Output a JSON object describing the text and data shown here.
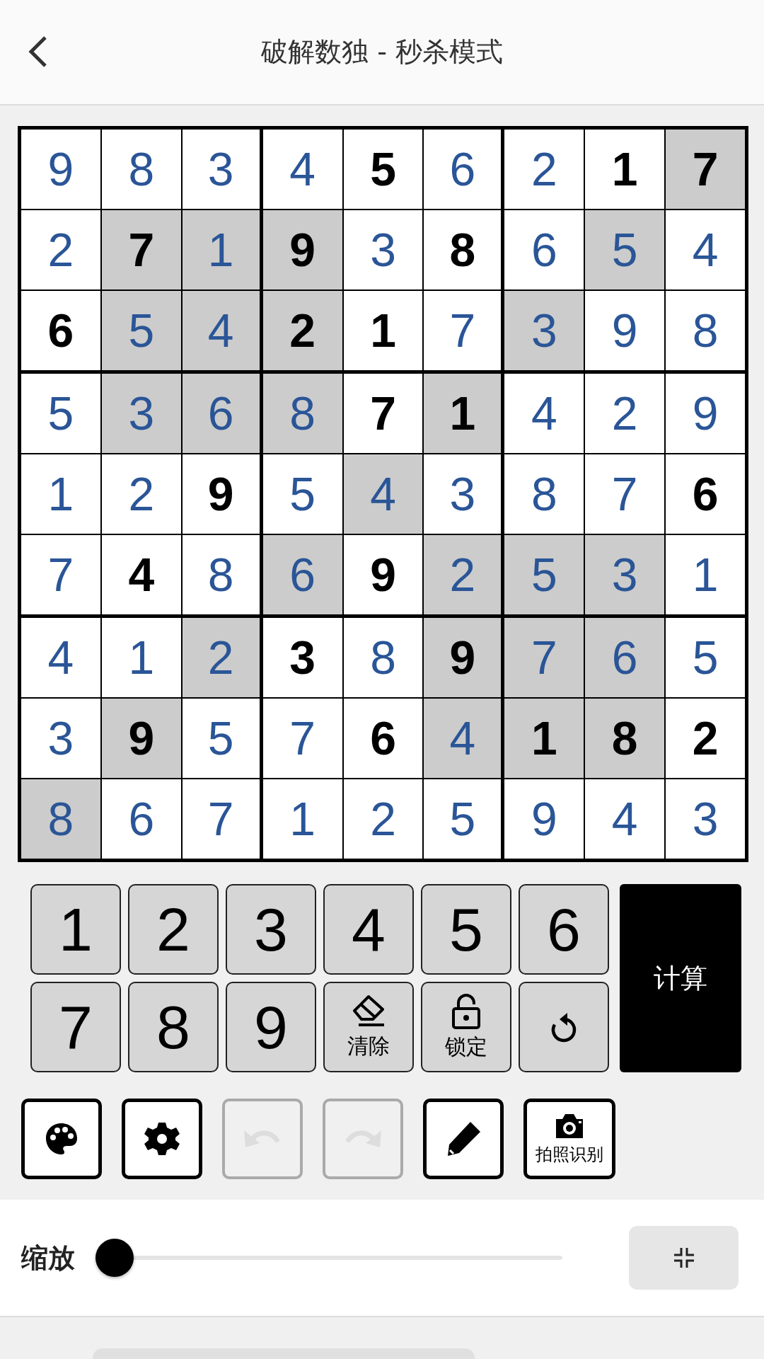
{
  "header": {
    "title": "破解数独 - 秒杀模式"
  },
  "grid": {
    "rows": [
      {
        "cells": [
          {
            "value": "9",
            "given": false,
            "shaded": false
          },
          {
            "value": "8",
            "given": false,
            "shaded": false
          },
          {
            "value": "3",
            "given": false,
            "shaded": false
          },
          {
            "value": "4",
            "given": false,
            "shaded": false
          },
          {
            "value": "5",
            "given": true,
            "shaded": false
          },
          {
            "value": "6",
            "given": false,
            "shaded": false
          },
          {
            "value": "2",
            "given": false,
            "shaded": false
          },
          {
            "value": "1",
            "given": true,
            "shaded": false
          },
          {
            "value": "7",
            "given": true,
            "shaded": true
          }
        ]
      },
      {
        "cells": [
          {
            "value": "2",
            "given": false,
            "shaded": false
          },
          {
            "value": "7",
            "given": true,
            "shaded": true
          },
          {
            "value": "1",
            "given": false,
            "shaded": true
          },
          {
            "value": "9",
            "given": true,
            "shaded": true
          },
          {
            "value": "3",
            "given": false,
            "shaded": false
          },
          {
            "value": "8",
            "given": true,
            "shaded": false
          },
          {
            "value": "6",
            "given": false,
            "shaded": false
          },
          {
            "value": "5",
            "given": false,
            "shaded": true
          },
          {
            "value": "4",
            "given": false,
            "shaded": false
          }
        ]
      },
      {
        "cells": [
          {
            "value": "6",
            "given": true,
            "shaded": false
          },
          {
            "value": "5",
            "given": false,
            "shaded": true
          },
          {
            "value": "4",
            "given": false,
            "shaded": true
          },
          {
            "value": "2",
            "given": true,
            "shaded": true
          },
          {
            "value": "1",
            "given": true,
            "shaded": false
          },
          {
            "value": "7",
            "given": false,
            "shaded": false
          },
          {
            "value": "3",
            "given": false,
            "shaded": true
          },
          {
            "value": "9",
            "given": false,
            "shaded": false
          },
          {
            "value": "8",
            "given": false,
            "shaded": false
          }
        ]
      },
      {
        "cells": [
          {
            "value": "5",
            "given": false,
            "shaded": false
          },
          {
            "value": "3",
            "given": false,
            "shaded": true
          },
          {
            "value": "6",
            "given": false,
            "shaded": true
          },
          {
            "value": "8",
            "given": false,
            "shaded": true
          },
          {
            "value": "7",
            "given": true,
            "shaded": false
          },
          {
            "value": "1",
            "given": true,
            "shaded": true
          },
          {
            "value": "4",
            "given": false,
            "shaded": false
          },
          {
            "value": "2",
            "given": false,
            "shaded": false
          },
          {
            "value": "9",
            "given": false,
            "shaded": false
          }
        ]
      },
      {
        "cells": [
          {
            "value": "1",
            "given": false,
            "shaded": false
          },
          {
            "value": "2",
            "given": false,
            "shaded": false
          },
          {
            "value": "9",
            "given": true,
            "shaded": false
          },
          {
            "value": "5",
            "given": false,
            "shaded": false
          },
          {
            "value": "4",
            "given": false,
            "shaded": true
          },
          {
            "value": "3",
            "given": false,
            "shaded": false
          },
          {
            "value": "8",
            "given": false,
            "shaded": false
          },
          {
            "value": "7",
            "given": false,
            "shaded": false
          },
          {
            "value": "6",
            "given": true,
            "shaded": false
          }
        ]
      },
      {
        "cells": [
          {
            "value": "7",
            "given": false,
            "shaded": false
          },
          {
            "value": "4",
            "given": true,
            "shaded": false
          },
          {
            "value": "8",
            "given": false,
            "shaded": false
          },
          {
            "value": "6",
            "given": false,
            "shaded": true
          },
          {
            "value": "9",
            "given": true,
            "shaded": false
          },
          {
            "value": "2",
            "given": false,
            "shaded": true
          },
          {
            "value": "5",
            "given": false,
            "shaded": true
          },
          {
            "value": "3",
            "given": false,
            "shaded": true
          },
          {
            "value": "1",
            "given": false,
            "shaded": false
          }
        ]
      },
      {
        "cells": [
          {
            "value": "4",
            "given": false,
            "shaded": false
          },
          {
            "value": "1",
            "given": false,
            "shaded": false
          },
          {
            "value": "2",
            "given": false,
            "shaded": true
          },
          {
            "value": "3",
            "given": true,
            "shaded": false
          },
          {
            "value": "8",
            "given": false,
            "shaded": false
          },
          {
            "value": "9",
            "given": true,
            "shaded": true
          },
          {
            "value": "7",
            "given": false,
            "shaded": true
          },
          {
            "value": "6",
            "given": false,
            "shaded": true
          },
          {
            "value": "5",
            "given": false,
            "shaded": false
          }
        ]
      },
      {
        "cells": [
          {
            "value": "3",
            "given": false,
            "shaded": false
          },
          {
            "value": "9",
            "given": true,
            "shaded": true
          },
          {
            "value": "5",
            "given": false,
            "shaded": false
          },
          {
            "value": "7",
            "given": false,
            "shaded": false
          },
          {
            "value": "6",
            "given": true,
            "shaded": false
          },
          {
            "value": "4",
            "given": false,
            "shaded": true
          },
          {
            "value": "1",
            "given": true,
            "shaded": true
          },
          {
            "value": "8",
            "given": true,
            "shaded": true
          },
          {
            "value": "2",
            "given": true,
            "shaded": false
          }
        ]
      },
      {
        "cells": [
          {
            "value": "8",
            "given": false,
            "shaded": true
          },
          {
            "value": "6",
            "given": false,
            "shaded": false
          },
          {
            "value": "7",
            "given": false,
            "shaded": false
          },
          {
            "value": "1",
            "given": false,
            "shaded": false
          },
          {
            "value": "2",
            "given": false,
            "shaded": false
          },
          {
            "value": "5",
            "given": false,
            "shaded": false
          },
          {
            "value": "9",
            "given": false,
            "shaded": false
          },
          {
            "value": "4",
            "given": false,
            "shaded": false
          },
          {
            "value": "3",
            "given": false,
            "shaded": false
          }
        ]
      }
    ]
  },
  "keypad": {
    "keys": [
      {
        "kind": "digit",
        "label": "1"
      },
      {
        "kind": "digit",
        "label": "2"
      },
      {
        "kind": "digit",
        "label": "3"
      },
      {
        "kind": "digit",
        "label": "4"
      },
      {
        "kind": "digit",
        "label": "5"
      },
      {
        "kind": "digit",
        "label": "6"
      },
      {
        "kind": "digit",
        "label": "7"
      },
      {
        "kind": "digit",
        "label": "8"
      },
      {
        "kind": "digit",
        "label": "9"
      },
      {
        "kind": "eraser",
        "label": "清除"
      },
      {
        "kind": "lock",
        "label": "锁定"
      },
      {
        "kind": "reset"
      }
    ],
    "compute_button": "计算"
  },
  "toolbar": {
    "buttons": [
      {
        "kind": "palette",
        "disabled": false
      },
      {
        "kind": "settings",
        "disabled": false
      },
      {
        "kind": "undo",
        "disabled": true
      },
      {
        "kind": "redo",
        "disabled": true
      },
      {
        "kind": "pencil",
        "disabled": false
      },
      {
        "kind": "camera",
        "label": "拍照识别",
        "disabled": false
      }
    ]
  },
  "zoom": {
    "label": "缩放",
    "level": 0
  }
}
